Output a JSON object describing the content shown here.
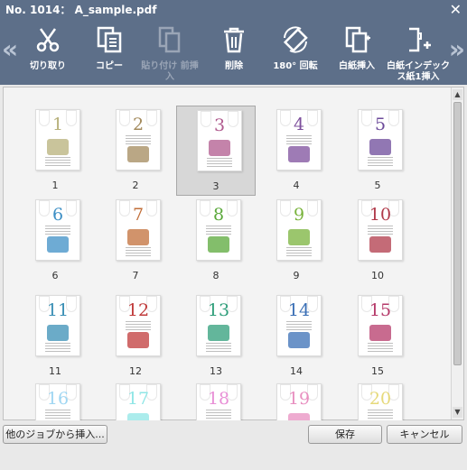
{
  "window": {
    "title": "No. 1014： A_sample.pdf",
    "close_glyph": "✕"
  },
  "toolbar": {
    "left_arrow": "«",
    "right_arrow": "»",
    "items": [
      {
        "label": "切り取り",
        "icon": "scissors-icon",
        "enabled": true
      },
      {
        "label": "コピー",
        "icon": "copy-icon",
        "enabled": true
      },
      {
        "label": "貼り付け 前挿入",
        "icon": "paste-icon",
        "enabled": false
      },
      {
        "label": "削除",
        "icon": "trash-icon",
        "enabled": true
      },
      {
        "label": "180° 回転",
        "icon": "rotate-icon",
        "enabled": true
      },
      {
        "label": "白紙挿入",
        "icon": "insert-blank-icon",
        "enabled": true
      },
      {
        "label": "白紙インデックス紙1挿入",
        "icon": "insert-index-icon",
        "enabled": true
      }
    ]
  },
  "pages": [
    {
      "label": "1",
      "num": "1",
      "color": "#b7b07a",
      "selected": false
    },
    {
      "label": "2",
      "num": "2",
      "color": "#a38a5c",
      "selected": false
    },
    {
      "label": "3",
      "num": "3",
      "color": "#b05a8e",
      "selected": true
    },
    {
      "label": "4",
      "num": "4",
      "color": "#7d4f9c",
      "selected": false
    },
    {
      "label": "5",
      "num": "5",
      "color": "#6c4a9a",
      "selected": false
    },
    {
      "label": "6",
      "num": "6",
      "color": "#3d8fc5",
      "selected": false
    },
    {
      "label": "7",
      "num": "7",
      "color": "#c26f3a",
      "selected": false
    },
    {
      "label": "8",
      "num": "8",
      "color": "#5aa83a",
      "selected": false
    },
    {
      "label": "9",
      "num": "9",
      "color": "#79b33c",
      "selected": false
    },
    {
      "label": "10",
      "num": "10",
      "color": "#b03a4a",
      "selected": false
    },
    {
      "label": "11",
      "num": "11",
      "color": "#3a8fb5",
      "selected": false
    },
    {
      "label": "12",
      "num": "12",
      "color": "#c03a3a",
      "selected": false
    },
    {
      "label": "13",
      "num": "13",
      "color": "#2f9e7a",
      "selected": false
    },
    {
      "label": "14",
      "num": "14",
      "color": "#3a6fb5",
      "selected": false
    },
    {
      "label": "15",
      "num": "15",
      "color": "#b53a6a",
      "selected": false
    },
    {
      "label": "",
      "num": "16",
      "color": "#9fd6f2",
      "selected": false
    },
    {
      "label": "",
      "num": "17",
      "color": "#8fe6e6",
      "selected": false
    },
    {
      "label": "",
      "num": "18",
      "color": "#e88fd6",
      "selected": false
    },
    {
      "label": "",
      "num": "19",
      "color": "#e88fc0",
      "selected": false
    },
    {
      "label": "",
      "num": "20",
      "color": "#e6d97a",
      "selected": false
    }
  ],
  "footer": {
    "insert_from_other_job": "他のジョブから挿入...",
    "save": "保存",
    "cancel": "キャンセル"
  }
}
